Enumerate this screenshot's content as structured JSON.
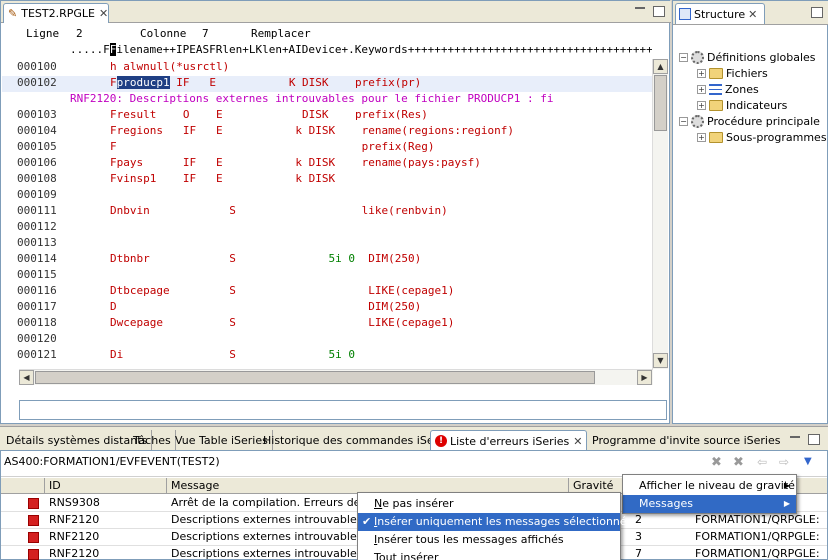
{
  "editor": {
    "tab_title": "TEST2.RPGLE",
    "status": {
      "ligne_label": "Ligne",
      "ligne_value": "2",
      "colonne_label": "Colonne",
      "colonne_value": "7",
      "mode": "Remplacer"
    },
    "ruler_prefix": ".....F",
    "ruler_cursor": "F",
    "ruler_rest": "ilename++IPEASFRlen+LKlen+AIDevice+.Keywords+++++++++++++++++++++++++++++++++++++++",
    "lines": [
      {
        "num": "000100",
        "text": "h alwnull(*usrctl)"
      },
      {
        "num": "000102",
        "pre": "F",
        "sel": "producp1",
        "text": " IF   E           K DISK    prefix(pr)"
      },
      {
        "msg": "RNF2120: Descriptions externes introuvables pour le fichier PRODUCP1 : fi"
      },
      {
        "num": "000103",
        "text": "Fresult    O    E            DISK    prefix(Res)"
      },
      {
        "num": "000104",
        "text": "Fregions   IF   E           k DISK    rename(regions:regionf)"
      },
      {
        "num": "000105",
        "text": "F                                     prefix(Reg)"
      },
      {
        "num": "000106",
        "text": "Fpays      IF   E           k DISK    rename(pays:paysf)"
      },
      {
        "num": "000108",
        "text": "Fvinsp1    IF   E           k DISK"
      },
      {
        "num": "000109",
        "text": ""
      },
      {
        "num": "000111",
        "text": "Dnbvin            S                   like(renbvin)"
      },
      {
        "num": "000112",
        "text": ""
      },
      {
        "num": "000113",
        "text": ""
      },
      {
        "num": "000114",
        "a": "Dtbnbr            S              ",
        "g": "5i 0",
        "b": "  DIM(250)"
      },
      {
        "num": "000115",
        "text": ""
      },
      {
        "num": "000116",
        "text": "Dtbcepage         S                    LIKE(cepage1)"
      },
      {
        "num": "000117",
        "text": "D                                      DIM(250)"
      },
      {
        "num": "000118",
        "text": "Dwcepage          S                    LIKE(cepage1)"
      },
      {
        "num": "000120",
        "text": ""
      },
      {
        "num": "000121",
        "a": "Di                S              ",
        "g": "5i 0",
        "b": ""
      }
    ]
  },
  "structure": {
    "tab_title": "Structure",
    "tree": [
      {
        "label": "Définitions globales",
        "expander": "−",
        "level": 0,
        "icon": "gear-icon"
      },
      {
        "label": "Fichiers",
        "expander": "+",
        "level": 1,
        "icon": "folder-icon"
      },
      {
        "label": "Zones",
        "expander": "+",
        "level": 1,
        "icon": "list-icon"
      },
      {
        "label": "Indicateurs",
        "expander": "+",
        "level": 1,
        "icon": "folder-icon"
      },
      {
        "label": "Procédure principale",
        "expander": "−",
        "level": 0,
        "icon": "gear-icon"
      },
      {
        "label": "Sous-programmes",
        "expander": "+",
        "level": 1,
        "icon": "folder-icon"
      }
    ]
  },
  "bottom_tabs": [
    {
      "label": "Détails systèmes distants"
    },
    {
      "label": "Tâches"
    },
    {
      "label": "Vue Table iSeries"
    },
    {
      "label": "Historique des commandes iSeries"
    },
    {
      "label": "Liste d'erreurs iSeries",
      "active": true
    },
    {
      "label": "Programme d'invite source iSeries"
    }
  ],
  "error_list": {
    "path": "AS400:FORMATION1/EVFEVENT(TEST2)",
    "columns": {
      "id": "ID",
      "message": "Message",
      "gravite": "Gravité"
    },
    "rows": [
      {
        "id": "RNS9308",
        "message": "Arrêt de la compilation. Erreurs de gravi",
        "gravite": "",
        "line": "",
        "file": ""
      },
      {
        "id": "RNF2120",
        "message": "Descriptions externes introuvables pou",
        "gravite": "",
        "line": "2",
        "file": "FORMATION1/QRPGLE:"
      },
      {
        "id": "RNF2120",
        "message": "Descriptions externes introuvables pou",
        "gravite": "",
        "line": "3",
        "file": "FORMATION1/QRPGLE:"
      },
      {
        "id": "RNF2120",
        "message": "Descriptions externes introuvables pou",
        "gravite": "",
        "line": "7",
        "file": "FORMATION1/QRPGLE:"
      }
    ]
  },
  "menu_primary": {
    "items": [
      {
        "label": "Afficher le niveau de gravité",
        "mnemonic_index": 0,
        "has_sub": true
      },
      {
        "label": "Messages",
        "mnemonic_index": 0,
        "has_sub": true,
        "selected": true
      }
    ]
  },
  "menu_messages": {
    "items": [
      {
        "label": "Ne pas insérer",
        "mnemonic": "N",
        "rest": "e pas insérer"
      },
      {
        "label": "Insérer uniquement les messages sélectionnés",
        "mnemonic": "I",
        "rest": "nsérer uniquement les messages sélectionnés",
        "checked": true,
        "selected": true
      },
      {
        "label": "Insérer tous les messages affichés",
        "mnemonic": "I",
        "rest": "nsérer tous les messages affichés"
      },
      {
        "label": "Tout insérer",
        "mnemonic": "T",
        "rest": "out insérer"
      }
    ]
  },
  "icons": {
    "accent": "#316ac5",
    "error": "#d42020",
    "code_red": "#c00000",
    "msg_magenta": "#c000c0"
  }
}
